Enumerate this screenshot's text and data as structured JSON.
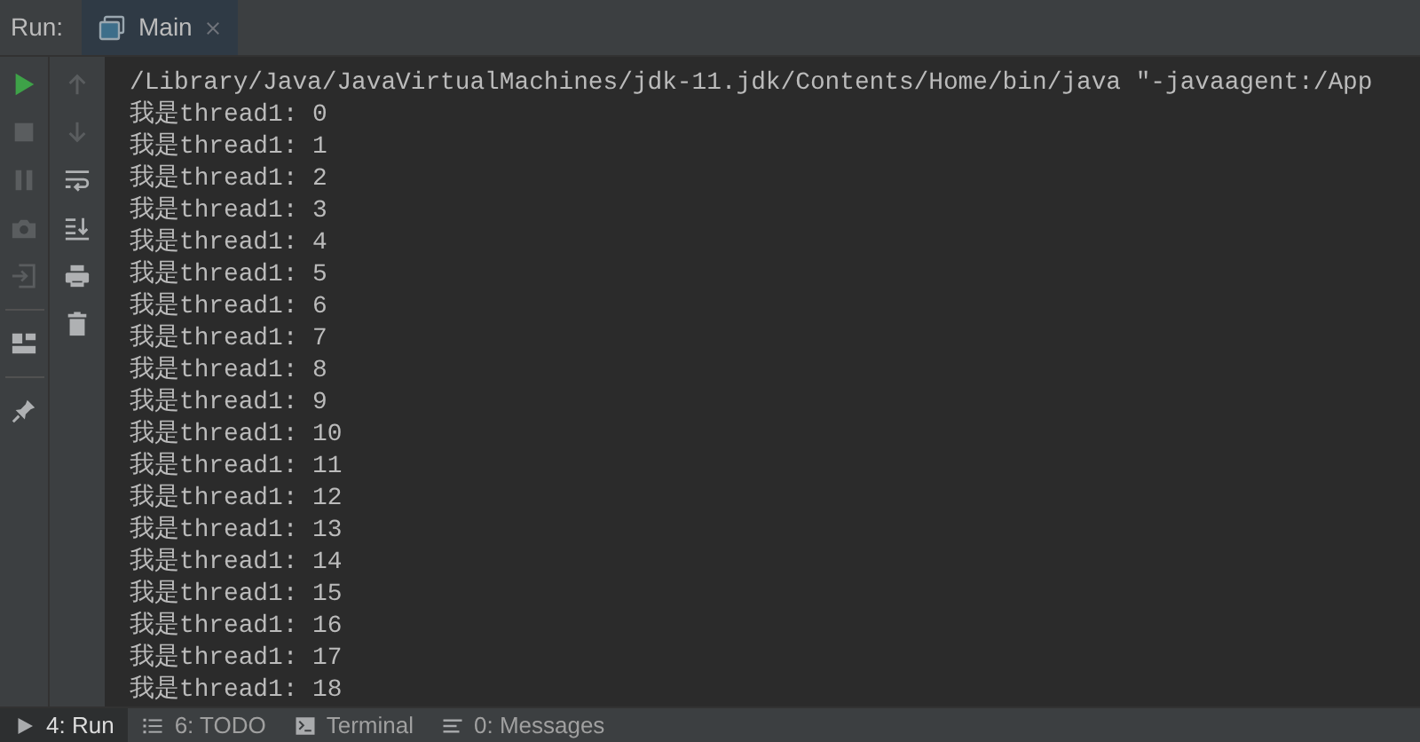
{
  "header": {
    "label": "Run:",
    "tabs": [
      {
        "label": "Main",
        "selected": true,
        "closable": true
      }
    ]
  },
  "toolbar_primary": [
    {
      "kind": "play",
      "disabled": false
    },
    {
      "kind": "stop",
      "disabled": true
    },
    {
      "kind": "pause",
      "disabled": true
    },
    {
      "kind": "camera",
      "disabled": true
    },
    {
      "kind": "exit",
      "disabled": true
    },
    {
      "kind": "separator"
    },
    {
      "kind": "layout",
      "disabled": false
    },
    {
      "kind": "separator"
    },
    {
      "kind": "pin",
      "disabled": false
    }
  ],
  "toolbar_secondary": [
    {
      "kind": "up",
      "disabled": true
    },
    {
      "kind": "down",
      "disabled": true
    },
    {
      "kind": "wrap",
      "disabled": false
    },
    {
      "kind": "scroll-end",
      "disabled": false
    },
    {
      "kind": "print",
      "disabled": false
    },
    {
      "kind": "trash",
      "disabled": false
    }
  ],
  "console": {
    "lines": [
      "/Library/Java/JavaVirtualMachines/jdk-11.jdk/Contents/Home/bin/java \"-javaagent:/App",
      "我是thread1: 0",
      "我是thread1: 1",
      "我是thread1: 2",
      "我是thread1: 3",
      "我是thread1: 4",
      "我是thread1: 5",
      "我是thread1: 6",
      "我是thread1: 7",
      "我是thread1: 8",
      "我是thread1: 9",
      "我是thread1: 10",
      "我是thread1: 11",
      "我是thread1: 12",
      "我是thread1: 13",
      "我是thread1: 14",
      "我是thread1: 15",
      "我是thread1: 16",
      "我是thread1: 17",
      "我是thread1: 18"
    ]
  },
  "bottom_tabs": [
    {
      "kind": "run",
      "label": "4: Run",
      "selected": true
    },
    {
      "kind": "list",
      "label": "6: TODO",
      "selected": false
    },
    {
      "kind": "terminal",
      "label": "Terminal",
      "selected": false
    },
    {
      "kind": "messages",
      "label": "0: Messages",
      "selected": false
    }
  ]
}
